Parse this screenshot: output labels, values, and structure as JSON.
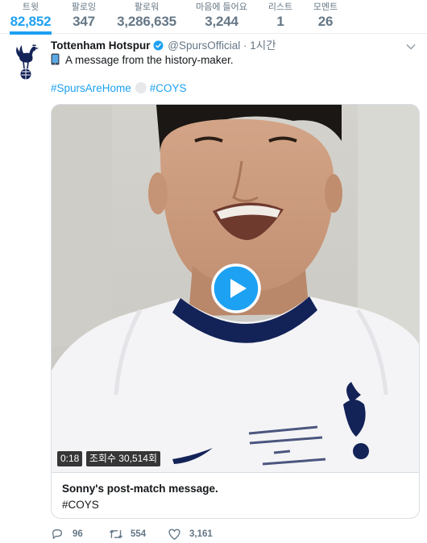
{
  "stats": [
    {
      "label": "트윗",
      "value": "82,852"
    },
    {
      "label": "팔로잉",
      "value": "347"
    },
    {
      "label": "팔로워",
      "value": "3,286,635"
    },
    {
      "label": "마음에 들어요",
      "value": "3,244"
    },
    {
      "label": "리스트",
      "value": "1"
    },
    {
      "label": "모멘트",
      "value": "26"
    }
  ],
  "tweet": {
    "name": "Tottenham Hotspur",
    "handle": "@SpursOfficial",
    "separator": "·",
    "time": "1시간",
    "text": "A message from the history-maker.",
    "hashtags": [
      "#SpursAreHome",
      "#COYS"
    ],
    "avatar_icon": "spurs-cockerel-logo",
    "card": {
      "duration": "0:18",
      "views": "조회수 30,514회",
      "title": "Sonny's post-match message.",
      "description": "#COYS"
    },
    "actions": {
      "replies": "96",
      "retweets": "554",
      "likes": "3,161"
    }
  },
  "colors": {
    "accent": "#1da1f2",
    "secondary_text": "#657786",
    "primary_text": "#14171a",
    "border": "#e6ecf0"
  }
}
